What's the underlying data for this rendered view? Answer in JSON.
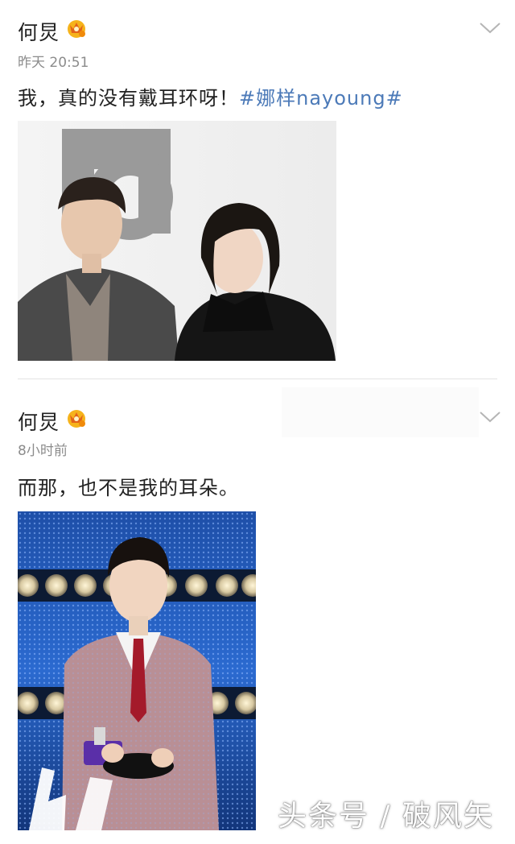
{
  "posts": [
    {
      "author": "何炅",
      "time": "昨天 20:51",
      "text": "我，真的没有戴耳环呀！",
      "hashtag": "#娜样nayoung#"
    },
    {
      "author": "何炅",
      "time": "8小时前",
      "text": "而那，也不是我的耳朵。"
    }
  ],
  "watermark": "头条号 / 破风矢",
  "icons": {
    "badge": "crown-badge-icon",
    "menu": "chevron-down-icon"
  },
  "colors": {
    "hashtag": "#4c7ab8",
    "badge": "#f2a20c",
    "text": "#222222",
    "meta": "#8c8c8c"
  }
}
